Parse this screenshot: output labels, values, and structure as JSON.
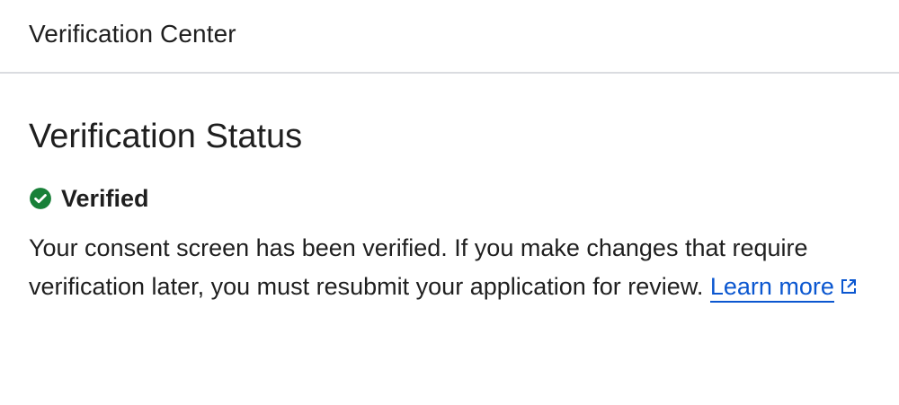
{
  "header": {
    "title": "Verification Center"
  },
  "main": {
    "section_title": "Verification Status",
    "status": {
      "label": "Verified",
      "icon": "check-circle-icon",
      "color": "#188038"
    },
    "description": "Your consent screen has been verified. If you make changes that require verification later, you must resubmit your application for review.",
    "learn_more": {
      "label": "Learn more",
      "icon": "open-in-new-icon",
      "color": "#0b57d0"
    }
  }
}
